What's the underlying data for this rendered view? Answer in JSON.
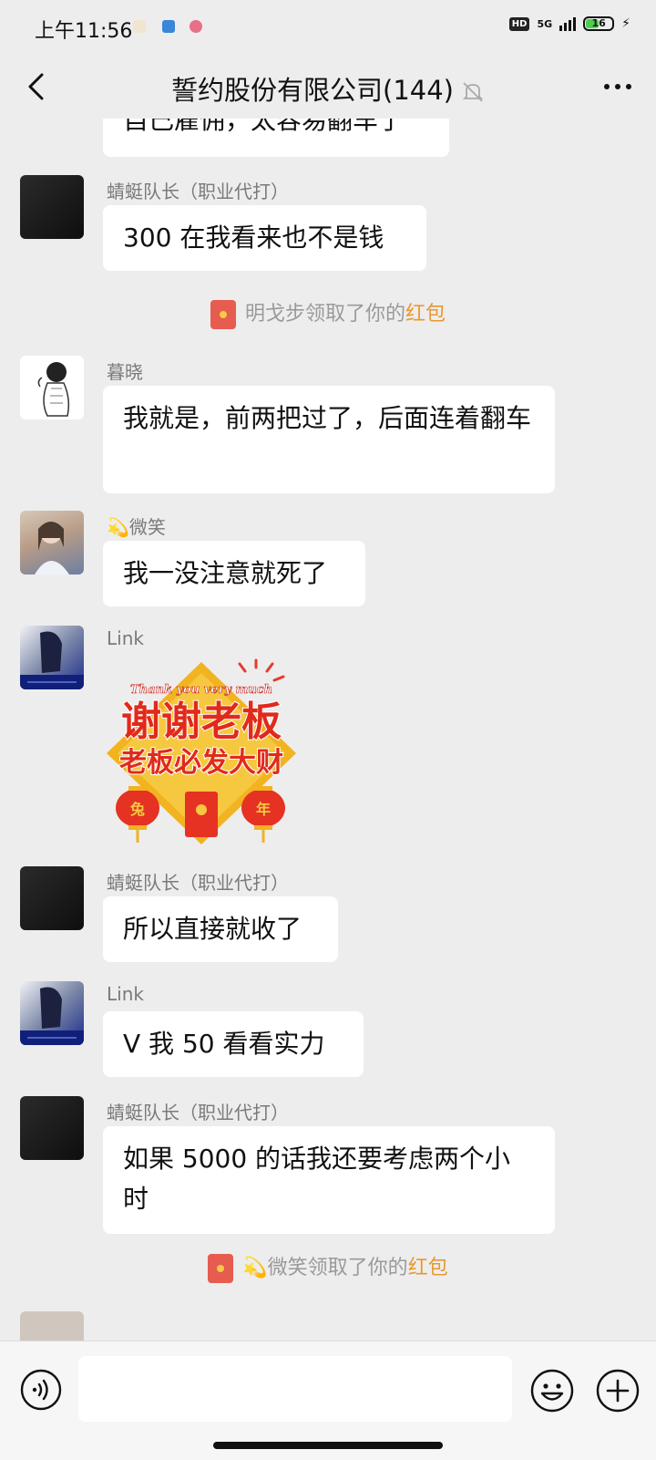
{
  "status_bar": {
    "time": "上午11:56",
    "hd": "HD",
    "network": "5G",
    "battery": "16"
  },
  "nav": {
    "title": "誓约股份有限公司(144)"
  },
  "messages": [
    {
      "type": "partial",
      "text": "自己雇佣，太容易翻车了"
    },
    {
      "type": "text",
      "sender": "蜻蜓队长（职业代打）",
      "text": "300 在我看来也不是钱"
    },
    {
      "type": "system",
      "text": "明戈步领取了你的",
      "link": "红包"
    },
    {
      "type": "text",
      "sender": "暮晓",
      "text": "我就是，前两把过了，后面连着翻车"
    },
    {
      "type": "text",
      "sender": "💫微笑",
      "text": "我一没注意就死了"
    },
    {
      "type": "sticker",
      "sender": "Link",
      "sticker": {
        "top_text": "Thank you very much",
        "line1": "谢谢老板",
        "line2": "老板必发大财",
        "left_lantern": "兔",
        "right_lantern": "年"
      }
    },
    {
      "type": "text",
      "sender": "蜻蜓队长（职业代打）",
      "text": "所以直接就收了"
    },
    {
      "type": "text",
      "sender": "Link",
      "text": "V 我 50 看看实力"
    },
    {
      "type": "text",
      "sender": "蜻蜓队长（职业代打）",
      "text": "如果 5000 的话我还要考虑两个小时"
    },
    {
      "type": "system",
      "text": "💫微笑领取了你的",
      "link": "红包"
    }
  ],
  "input": {
    "placeholder": ""
  },
  "icons": {
    "back": "chevron-left-icon",
    "mute": "bell-muted-icon",
    "more": "more-dots-icon",
    "voice": "voice-icon",
    "emoji": "emoji-icon",
    "plus": "plus-icon"
  },
  "colors": {
    "background": "#ededed",
    "bubble": "#ffffff",
    "red_packet_link": "#e9982f",
    "red_packet": "#e65c4f"
  }
}
